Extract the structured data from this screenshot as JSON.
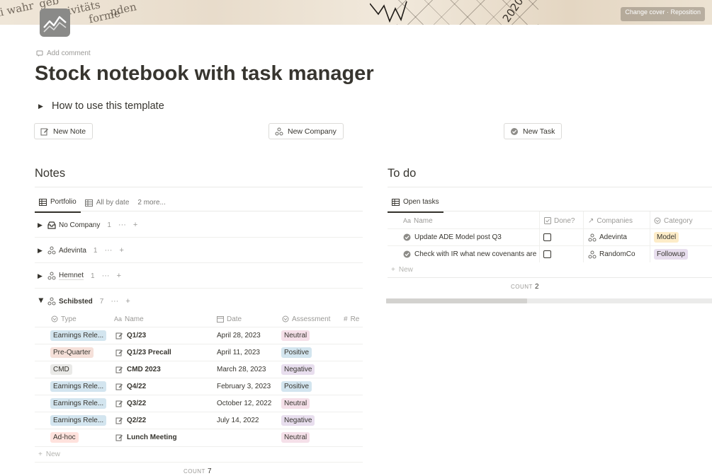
{
  "cover": {
    "change_cover_label": "Change cover",
    "reposition_label": "Reposition",
    "year_text": "2020"
  },
  "page": {
    "icon": "chart-icon",
    "add_comment": "Add comment",
    "title": "Stock notebook with task manager",
    "toggle_label": "How to use this template"
  },
  "buttons": {
    "new_note": "New Note",
    "new_company": "New Company",
    "new_task": "New Task"
  },
  "notes": {
    "heading": "Notes",
    "tabs": [
      {
        "label": "Portfolio",
        "icon": "table-icon"
      },
      {
        "label": "All by date",
        "icon": "table-icon"
      },
      {
        "label": "2 more..."
      }
    ],
    "groups": [
      {
        "label": "No Company",
        "count": "1",
        "icon": "inbox-icon"
      },
      {
        "label": "Adevinta",
        "count": "1",
        "icon": "company-icon"
      },
      {
        "label": "Hemnet",
        "count": "1",
        "icon": "company-icon"
      },
      {
        "label": "Schibsted",
        "count": "7",
        "icon": "company-icon"
      }
    ],
    "columns": {
      "type": "Type",
      "name": "Name",
      "date": "Date",
      "assessment": "Assessment",
      "rel": "Re"
    },
    "rows": [
      {
        "type": "Earnings Rele...",
        "name": "Q1/23",
        "date": "April 28, 2023",
        "assessment": "Neutral"
      },
      {
        "type": "Pre-Quarter",
        "name": "Q1/23 Precall",
        "date": "April 11, 2023",
        "assessment": "Positive"
      },
      {
        "type": "CMD",
        "name": "CMD 2023",
        "date": "March 28, 2023",
        "assessment": "Negative"
      },
      {
        "type": "Earnings Rele...",
        "name": "Q4/22",
        "date": "February 3, 2023",
        "assessment": "Positive"
      },
      {
        "type": "Earnings Rele...",
        "name": "Q3/22",
        "date": "October 12, 2022",
        "assessment": "Neutral"
      },
      {
        "type": "Earnings Rele...",
        "name": "Q2/22",
        "date": "July 14, 2022",
        "assessment": "Negative"
      },
      {
        "type": "Ad-hoc",
        "name": "Lunch Meeting",
        "date": "",
        "assessment": "Neutral"
      }
    ],
    "new_label": "New",
    "count_label": "COUNT",
    "count_value": "7"
  },
  "todo": {
    "heading": "To do",
    "tab": "Open tasks",
    "columns": {
      "name": "Name",
      "done": "Done?",
      "companies": "Companies",
      "category": "Category"
    },
    "rows": [
      {
        "name": "Update ADE Model post Q3",
        "done": false,
        "company": "Adevinta",
        "category": "Model"
      },
      {
        "name": "Check with IR what new covenants are",
        "done": false,
        "company": "RandomCo",
        "category": "Followup"
      }
    ],
    "new_label": "New",
    "count_label": "COUNT",
    "count_value": "2"
  },
  "tag_colors": {
    "Earnings Rele...": "#d3e5ef",
    "Pre-Quarter": "#f5e0d9",
    "CMD": "#e9e9e7",
    "Ad-hoc": "#ffe2dd",
    "Neutral": "#f5e0e9",
    "Positive": "#d3e5ef",
    "Negative": "#e8deee",
    "Model": "#fdecc8",
    "Followup": "#e8deee"
  }
}
